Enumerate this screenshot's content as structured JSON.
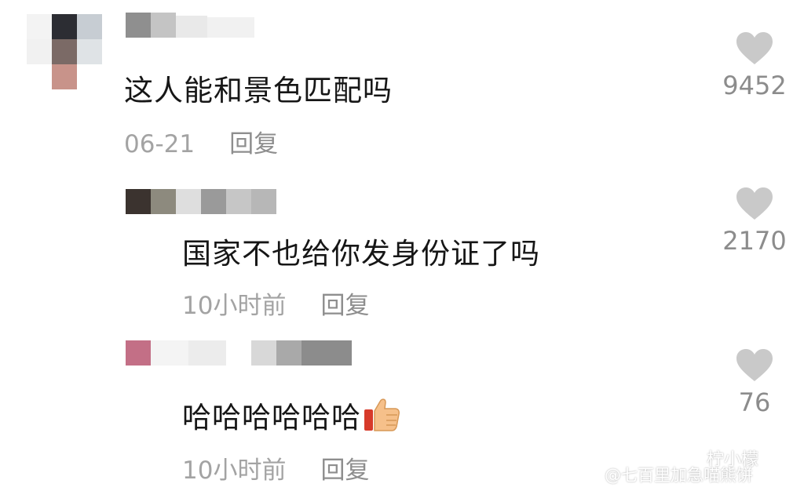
{
  "comments": [
    {
      "text": "这人能和景色匹配吗",
      "date": "06-21",
      "reply_label": "回复",
      "likes": "9452"
    },
    {
      "text": "国家不也给你发身份证了吗",
      "date": "10小时前",
      "reply_label": "回复",
      "likes": "2170"
    },
    {
      "text": "哈哈哈哈哈哈",
      "emoji": "thumbs-up-icon",
      "date": "10小时前",
      "reply_label": "回复",
      "likes": "76"
    }
  ],
  "watermark": {
    "wechat": "柠小檬",
    "weibo": "@七百里加急喵熊饼"
  },
  "colors": {
    "heart": "#c9c9c9",
    "meta": "#a3a3a3",
    "text": "#161616"
  }
}
